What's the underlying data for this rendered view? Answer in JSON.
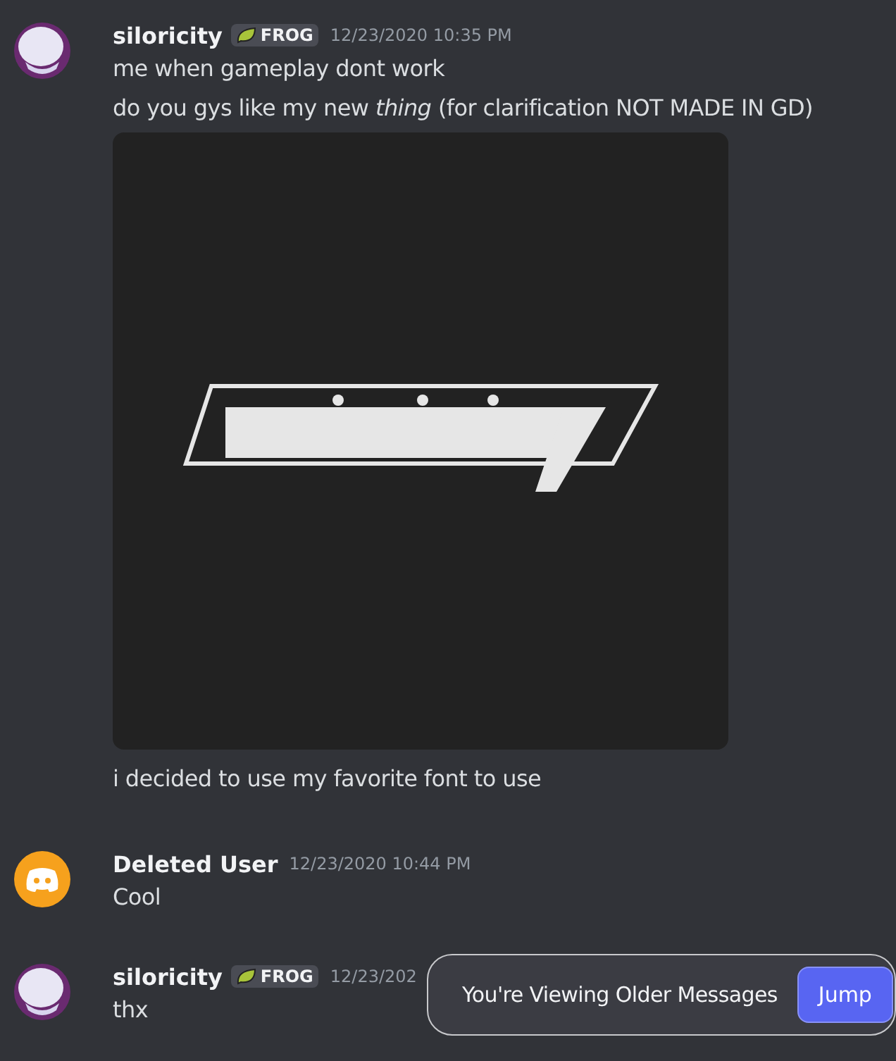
{
  "messages": [
    {
      "author": "siloricity",
      "avatar": {
        "kind": "character"
      },
      "badge": "FROG",
      "timestamp": "12/23/2020 10:35 PM",
      "content": [
        {
          "kind": "text",
          "text": "me when gameplay dont work"
        },
        {
          "kind": "text",
          "text": "do you gys like my new *thing* (for clarification NOT MADE IN GD)"
        },
        {
          "kind": "picture"
        },
        {
          "kind": "text",
          "text": "i decided to use my favorite font to use"
        }
      ]
    },
    {
      "author": "Deleted User",
      "avatar": {
        "kind": "default"
      },
      "timestamp": "12/23/2020 10:44 PM",
      "content": [
        {
          "kind": "text",
          "text": "Cool"
        }
      ]
    },
    {
      "author": "siloricity",
      "avatar": {
        "kind": "character"
      },
      "badge": "FROG",
      "timestamp": "12/23/202",
      "content": [
        {
          "kind": "text",
          "text": "thx"
        }
      ]
    }
  ],
  "toast": {
    "text": "You're Viewing Older Messages",
    "button": "Jump"
  }
}
